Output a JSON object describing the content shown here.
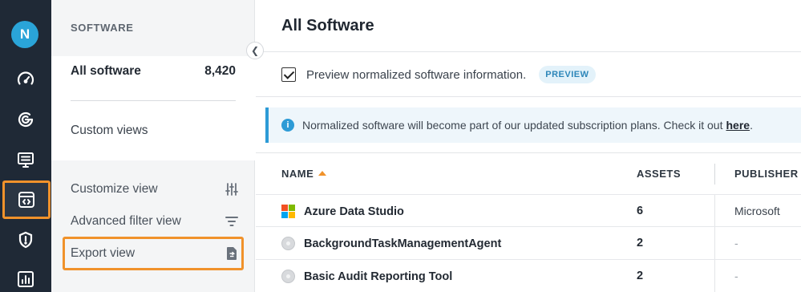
{
  "user": {
    "avatar_initial": "N"
  },
  "nav_rail": {
    "items": [
      {
        "icon": "dashboard-gauge-icon"
      },
      {
        "icon": "insights-icon"
      },
      {
        "icon": "assets-monitor-icon"
      },
      {
        "icon": "software-code-icon",
        "active": true
      },
      {
        "icon": "security-shield-icon"
      },
      {
        "icon": "reports-chart-icon"
      }
    ]
  },
  "sidebar": {
    "section_title": "SOFTWARE",
    "all_software": {
      "label": "All software",
      "count": "8,420"
    },
    "custom_views_label": "Custom views",
    "actions": [
      {
        "label": "Customize view",
        "icon": "sliders-icon"
      },
      {
        "label": "Advanced filter view",
        "icon": "filter-icon"
      },
      {
        "label": "Export view",
        "icon": "export-file-icon"
      }
    ]
  },
  "main": {
    "title": "All Software",
    "preview": {
      "checked": true,
      "label": "Preview normalized software information.",
      "badge": "PREVIEW"
    },
    "banner": {
      "text": "Normalized software will become part of our updated subscription plans. Check it out",
      "link": "here",
      "suffix": "."
    },
    "table": {
      "columns": {
        "name": "NAME",
        "assets": "ASSETS",
        "publisher": "PUBLISHER"
      },
      "sort": {
        "column": "name",
        "direction": "ascending"
      },
      "rows": [
        {
          "name": "Azure Data Studio",
          "assets": "6",
          "publisher": "Microsoft",
          "icon": "microsoft-logo"
        },
        {
          "name": "BackgroundTaskManagementAgent",
          "assets": "2",
          "publisher": "-",
          "icon": "generic-disc-icon"
        },
        {
          "name": "Basic Audit Reporting Tool",
          "assets": "2",
          "publisher": "-",
          "icon": "generic-disc-icon"
        }
      ]
    }
  },
  "colors": {
    "rail_bg": "#1f2936",
    "highlight_orange": "#f0922b",
    "accent_blue": "#2d9bd6",
    "avatar_bg": "#2aa4d8"
  }
}
